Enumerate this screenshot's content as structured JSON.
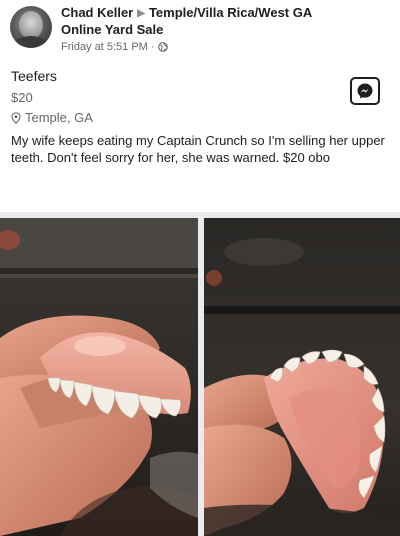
{
  "post": {
    "author": "Chad Keller",
    "group": "Temple/Villa Rica/West GA",
    "group_cont": "Online Yard Sale",
    "timestamp": "Friday at 5:51 PM",
    "separator": "·",
    "privacy_icon": "globe-icon"
  },
  "listing": {
    "title": "Teefers",
    "price": "$20",
    "location": "Temple, GA",
    "description": "My wife keeps eating my Captain Crunch so I'm selling her upper teeth. Don't feel sorry for her, she was warned. $20 obo"
  },
  "actions": {
    "message_icon": "messenger-icon"
  },
  "colors": {
    "text": "#1c1e21",
    "meta": "#65676b",
    "divider": "#e9ebee"
  }
}
